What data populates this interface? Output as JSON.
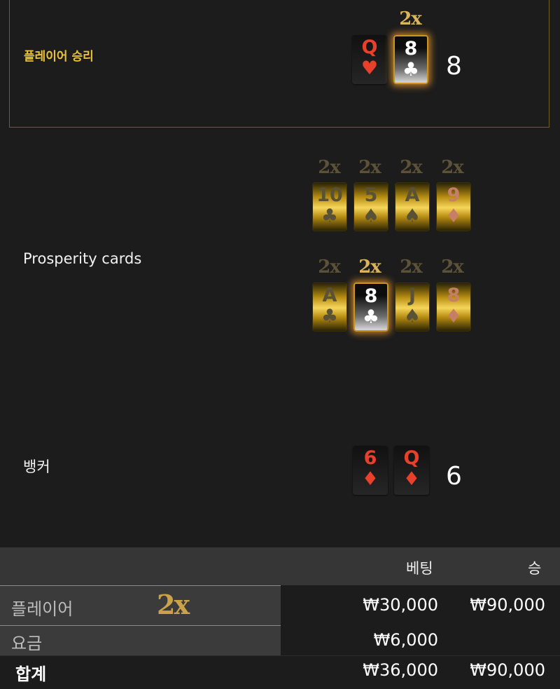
{
  "player": {
    "label": "플레이어 승리",
    "multiplier": "2x",
    "cards": [
      {
        "rank": "Q",
        "suit": "♥",
        "style": "plain"
      },
      {
        "rank": "8",
        "suit": "♣",
        "style": "win"
      }
    ],
    "score": "8"
  },
  "prosperity": {
    "label": "Prosperity cards",
    "row1": [
      {
        "mult": "2x",
        "rank": "10",
        "suit": "♣",
        "style": "gold"
      },
      {
        "mult": "2x",
        "rank": "5",
        "suit": "♠",
        "style": "gold"
      },
      {
        "mult": "2x",
        "rank": "A",
        "suit": "♠",
        "style": "gold"
      },
      {
        "mult": "2x",
        "rank": "9",
        "suit": "♦",
        "style": "gold-red"
      }
    ],
    "row2": [
      {
        "mult": "2x",
        "rank": "A",
        "suit": "♣",
        "style": "gold"
      },
      {
        "mult": "2x",
        "rank": "8",
        "suit": "♣",
        "style": "win"
      },
      {
        "mult": "2x",
        "rank": "J",
        "suit": "♠",
        "style": "gold"
      },
      {
        "mult": "2x",
        "rank": "8",
        "suit": "♦",
        "style": "gold-red"
      }
    ]
  },
  "banker": {
    "label": "뱅커",
    "cards": [
      {
        "rank": "6",
        "suit": "♦",
        "style": "plain"
      },
      {
        "rank": "Q",
        "suit": "♦",
        "style": "plain"
      }
    ],
    "score": "6"
  },
  "table": {
    "col_bet": "베팅",
    "col_win": "승",
    "rows": [
      {
        "label": "플레이어",
        "badge": "2x",
        "bet": "₩30,000",
        "win": "₩90,000"
      },
      {
        "label": "요금",
        "bet": "₩6,000",
        "win": ""
      },
      {
        "label": "합계",
        "bet": "₩36,000",
        "win": "₩90,000"
      }
    ]
  }
}
